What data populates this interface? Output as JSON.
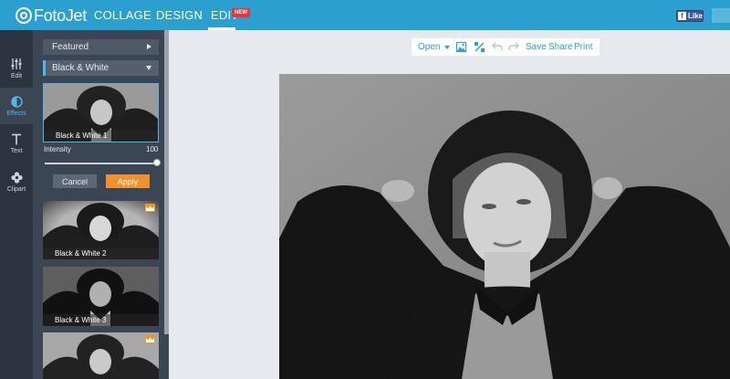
{
  "app": {
    "logo_text": "FotoJet",
    "nav": {
      "collage": "COLLAGE",
      "design": "DESIGN",
      "edit": "EDIT",
      "new_badge": "NEW"
    },
    "fb_like": "Like"
  },
  "rail": {
    "items": [
      {
        "label": "Edit",
        "icon": "sliders-icon"
      },
      {
        "label": "Effects",
        "icon": "contrast-icon",
        "active": true
      },
      {
        "label": "Text",
        "icon": "text-icon"
      },
      {
        "label": "Clipart",
        "icon": "clipart-icon"
      }
    ]
  },
  "panel": {
    "category": "Featured",
    "subcategory": "Black & White",
    "intensity_label": "Intensity",
    "intensity_value": "100",
    "cancel_label": "Cancel",
    "apply_label": "Apply",
    "effects": [
      {
        "label": "Black & White 1",
        "selected": true,
        "premium": false
      },
      {
        "label": "Black & White 2",
        "selected": false,
        "premium": true
      },
      {
        "label": "Black & White 3",
        "selected": false,
        "premium": false
      },
      {
        "label": "",
        "selected": false,
        "premium": true
      }
    ]
  },
  "toolbar": {
    "open_label": "Open",
    "save_label": "Save",
    "share_label": "Share",
    "print_label": "Print"
  },
  "colors": {
    "topbar": "#2ba0d0",
    "rail": "#2c3440",
    "panel": "#3b4655",
    "accent": "#58b4e0",
    "apply": "#f0922b"
  }
}
